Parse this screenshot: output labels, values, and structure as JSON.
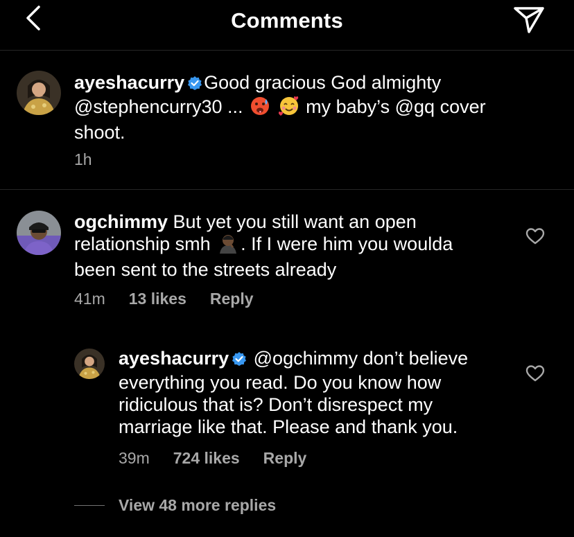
{
  "header": {
    "title": "Comments",
    "back_icon": "chevron-left-icon",
    "send_icon": "paper-plane-icon"
  },
  "caption": {
    "username": "ayeshacurry",
    "verified": true,
    "line1": "Good gracious God almighty",
    "line2a": "@stephencurry30 ...",
    "line2b": "my baby’s @gq cover",
    "line3": "shoot.",
    "time": "1h"
  },
  "comment": {
    "username": "ogchimmy",
    "line1": "But yet you still want an open",
    "line2a": "relationship smh",
    "line2b": ". If I were him you woulda",
    "line3": "been sent to the streets already",
    "time": "41m",
    "likes": "13 likes",
    "reply": "Reply"
  },
  "reply_comment": {
    "username": "ayeshacurry",
    "verified": true,
    "line1": "@ogchimmy don’t believe",
    "line2": "everything you read. Do you know how",
    "line3": "ridiculous that is? Don’t disrespect my",
    "line4": "marriage like that. Please and thank you.",
    "time": "39m",
    "likes": "724 likes",
    "reply": "Reply"
  },
  "view_more": "View 48 more replies",
  "colors": {
    "background": "#000000",
    "text": "#ffffff",
    "muted": "#a8a8a8",
    "verified": "#3897f0",
    "divider": "#262626"
  }
}
